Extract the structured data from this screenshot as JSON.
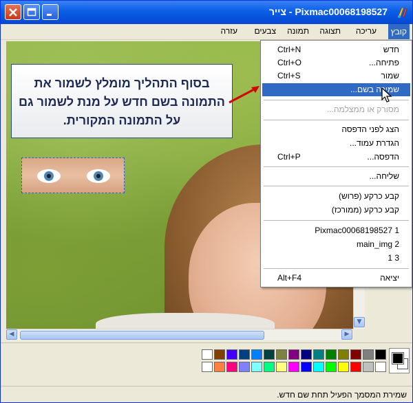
{
  "window": {
    "title": "Pixmac00068198527 - צייר",
    "buttons": {
      "close": "close",
      "maximize": "maximize",
      "minimize": "minimize"
    }
  },
  "menubar": {
    "items": [
      {
        "label": "קובץ",
        "active": true
      },
      {
        "label": "עריכה",
        "active": false
      },
      {
        "label": "תצוגה",
        "active": false
      },
      {
        "label": "תמונה",
        "active": false
      },
      {
        "label": "צבעים",
        "active": false
      },
      {
        "label": "עזרה",
        "active": false
      }
    ]
  },
  "file_menu": {
    "items": [
      {
        "label": "חדש",
        "shortcut": "Ctrl+N"
      },
      {
        "label": "פתיחה...",
        "shortcut": "Ctrl+O"
      },
      {
        "label": "שמור",
        "shortcut": "Ctrl+S"
      },
      {
        "label": "שמירה בשם...",
        "shortcut": "",
        "highlighted": true
      },
      {
        "label": "מסורק או ממצלמה...",
        "shortcut": "",
        "disabled": true
      },
      {
        "label": "הצג לפני הדפסה",
        "shortcut": ""
      },
      {
        "label": "הגדרת עמוד...",
        "shortcut": ""
      },
      {
        "label": "הדפסה...",
        "shortcut": "Ctrl+P"
      },
      {
        "label": "שליחה...",
        "shortcut": ""
      },
      {
        "label": "קבע כרקע (פרוש)",
        "shortcut": ""
      },
      {
        "label": "קבע כרקע (ממורכז)",
        "shortcut": ""
      },
      {
        "label": "Pixmac00068198527 1",
        "shortcut": ""
      },
      {
        "label": "main_img 2",
        "shortcut": ""
      },
      {
        "label": "1 3",
        "shortcut": ""
      },
      {
        "label": "יציאה",
        "shortcut": "Alt+F4"
      }
    ]
  },
  "callout": {
    "text": "בסוף התהליך מומלץ לשמור את התמונה בשם חדש על מנת לשמור גם על התמונה המקורית."
  },
  "palette": {
    "top_row": [
      "#000000",
      "#7f7f7f",
      "#800000",
      "#808000",
      "#008000",
      "#008080",
      "#000080",
      "#800080",
      "#808040",
      "#004040",
      "#0080ff",
      "#004080",
      "#4000ff",
      "#804000",
      "#ffffff"
    ],
    "bottom_row": [
      "#ffffff",
      "#c0c0c0",
      "#ff0000",
      "#ffff00",
      "#00ff00",
      "#00ffff",
      "#0000ff",
      "#ff00ff",
      "#ffff80",
      "#00ff80",
      "#80ffff",
      "#8080ff",
      "#ff0080",
      "#ff8040",
      "#ffffff"
    ],
    "foreground": "#000000",
    "background": "#ffffff"
  },
  "statusbar": {
    "text": "שמירת המסמך הפעיל תחת שם חדש."
  },
  "colors": {
    "titlebar": "#0a5ee8",
    "menu_highlight": "#316ac5",
    "callout_arrow": "#d40000"
  }
}
